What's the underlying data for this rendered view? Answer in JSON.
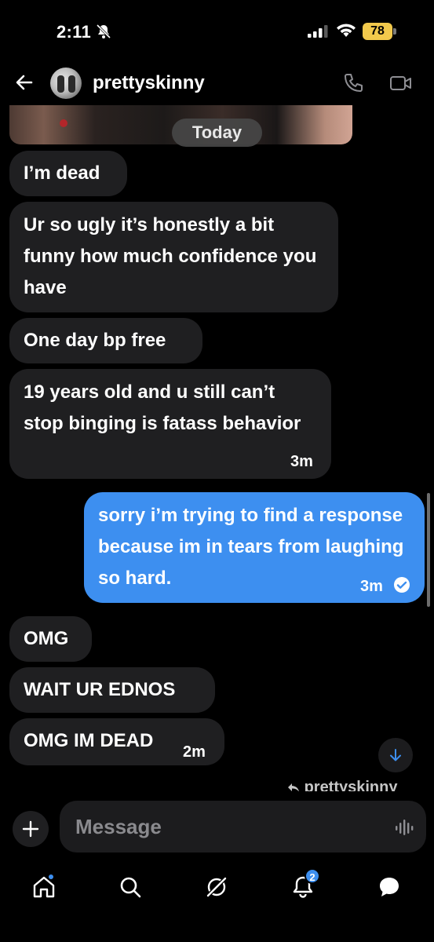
{
  "status_bar": {
    "time": "2:11",
    "battery": "78"
  },
  "header": {
    "name": "prettyskinny"
  },
  "date_separator": "Today",
  "messages": [
    {
      "text": "I’m dead",
      "time": ""
    },
    {
      "text": "Ur so ugly it’s honestly a bit funny how much confidence you have",
      "time": ""
    },
    {
      "text": "One day bp free",
      "time": ""
    },
    {
      "text": "19 years old and u still can’t stop binging is fatass behavior",
      "time": "3m"
    },
    {
      "text": "sorry i’m trying to find a response because im in tears from laughing so hard.",
      "time": "3m"
    },
    {
      "text": "OMG",
      "time": ""
    },
    {
      "text": "WAIT UR EDNOS",
      "time": ""
    },
    {
      "text": "OMG IM DEAD",
      "time": "2m"
    }
  ],
  "reply_label": "prettyskinny",
  "composer": {
    "placeholder": "Message"
  },
  "tab_bar": {
    "notification_count": "2"
  },
  "colors": {
    "accent": "#3d8ff0",
    "received_bubble": "#1f1f21",
    "battery": "#f2c94c"
  }
}
